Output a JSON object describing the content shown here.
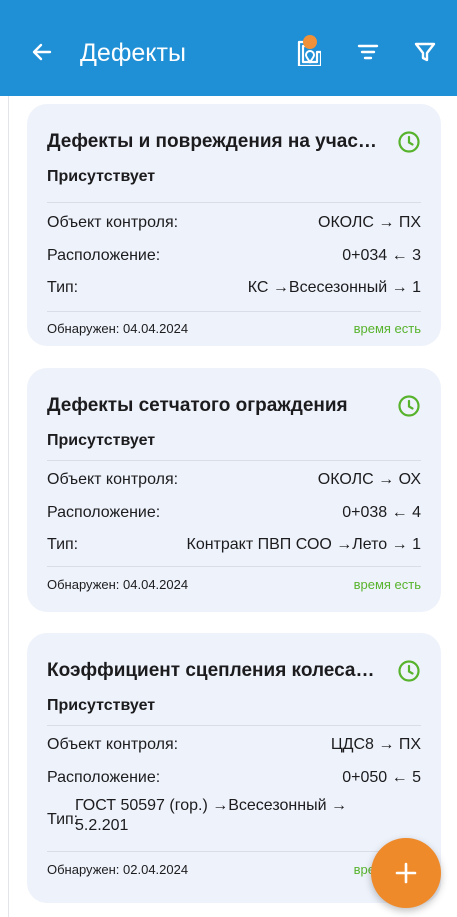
{
  "appbar": {
    "title": "Дефекты",
    "back_icon": "arrow-left-icon",
    "map_icon": "map-pin-icon",
    "sort_icon": "sort-lines-icon",
    "filter_icon": "funnel-icon",
    "color": "#1f8fd6",
    "badge_color": "#f0913a"
  },
  "defects": [
    {
      "title": "Дефекты и повреждения на участке",
      "status": "Присутствует",
      "object_label": "Объект контроля:",
      "object_value": "ОКОЛС → ПХ",
      "location_label": "Расположение:",
      "location_value": "0+034 ← 3",
      "type_label": "Тип:",
      "type_value": "КС →Всесезонный → 1",
      "found": "Обнаружен: 04.04.2024",
      "time": "время есть"
    },
    {
      "title": "Дефекты сетчатого ограждения",
      "status": "Присутствует",
      "object_label": "Объект контроля:",
      "object_value": "ОКОЛС → ОХ",
      "location_label": "Расположение:",
      "location_value": "0+038 ← 4",
      "type_label": "Тип:",
      "type_value": "Контракт ПВП СОО →Лето → 1",
      "found": "Обнаружен: 04.04.2024",
      "time": "время есть"
    },
    {
      "title": "Коэффициент сцепления колеса с покрытием",
      "status": "Присутствует",
      "object_label": "Объект контроля:",
      "object_value": "ЦДС8 → ПХ",
      "location_label": "Расположение:",
      "location_value": "0+050 ← 5",
      "type_label": "Тип:",
      "type_value": "ГОСТ 50597 (гор.) →Всесезонный → 5.2.201",
      "found": "Обнаружен: 02.04.2024",
      "time": "время есть"
    }
  ],
  "fab": {
    "icon": "plus-icon",
    "color": "#ef8a2a"
  },
  "status_icon": "clock-icon",
  "accent_green": "#57b32c"
}
